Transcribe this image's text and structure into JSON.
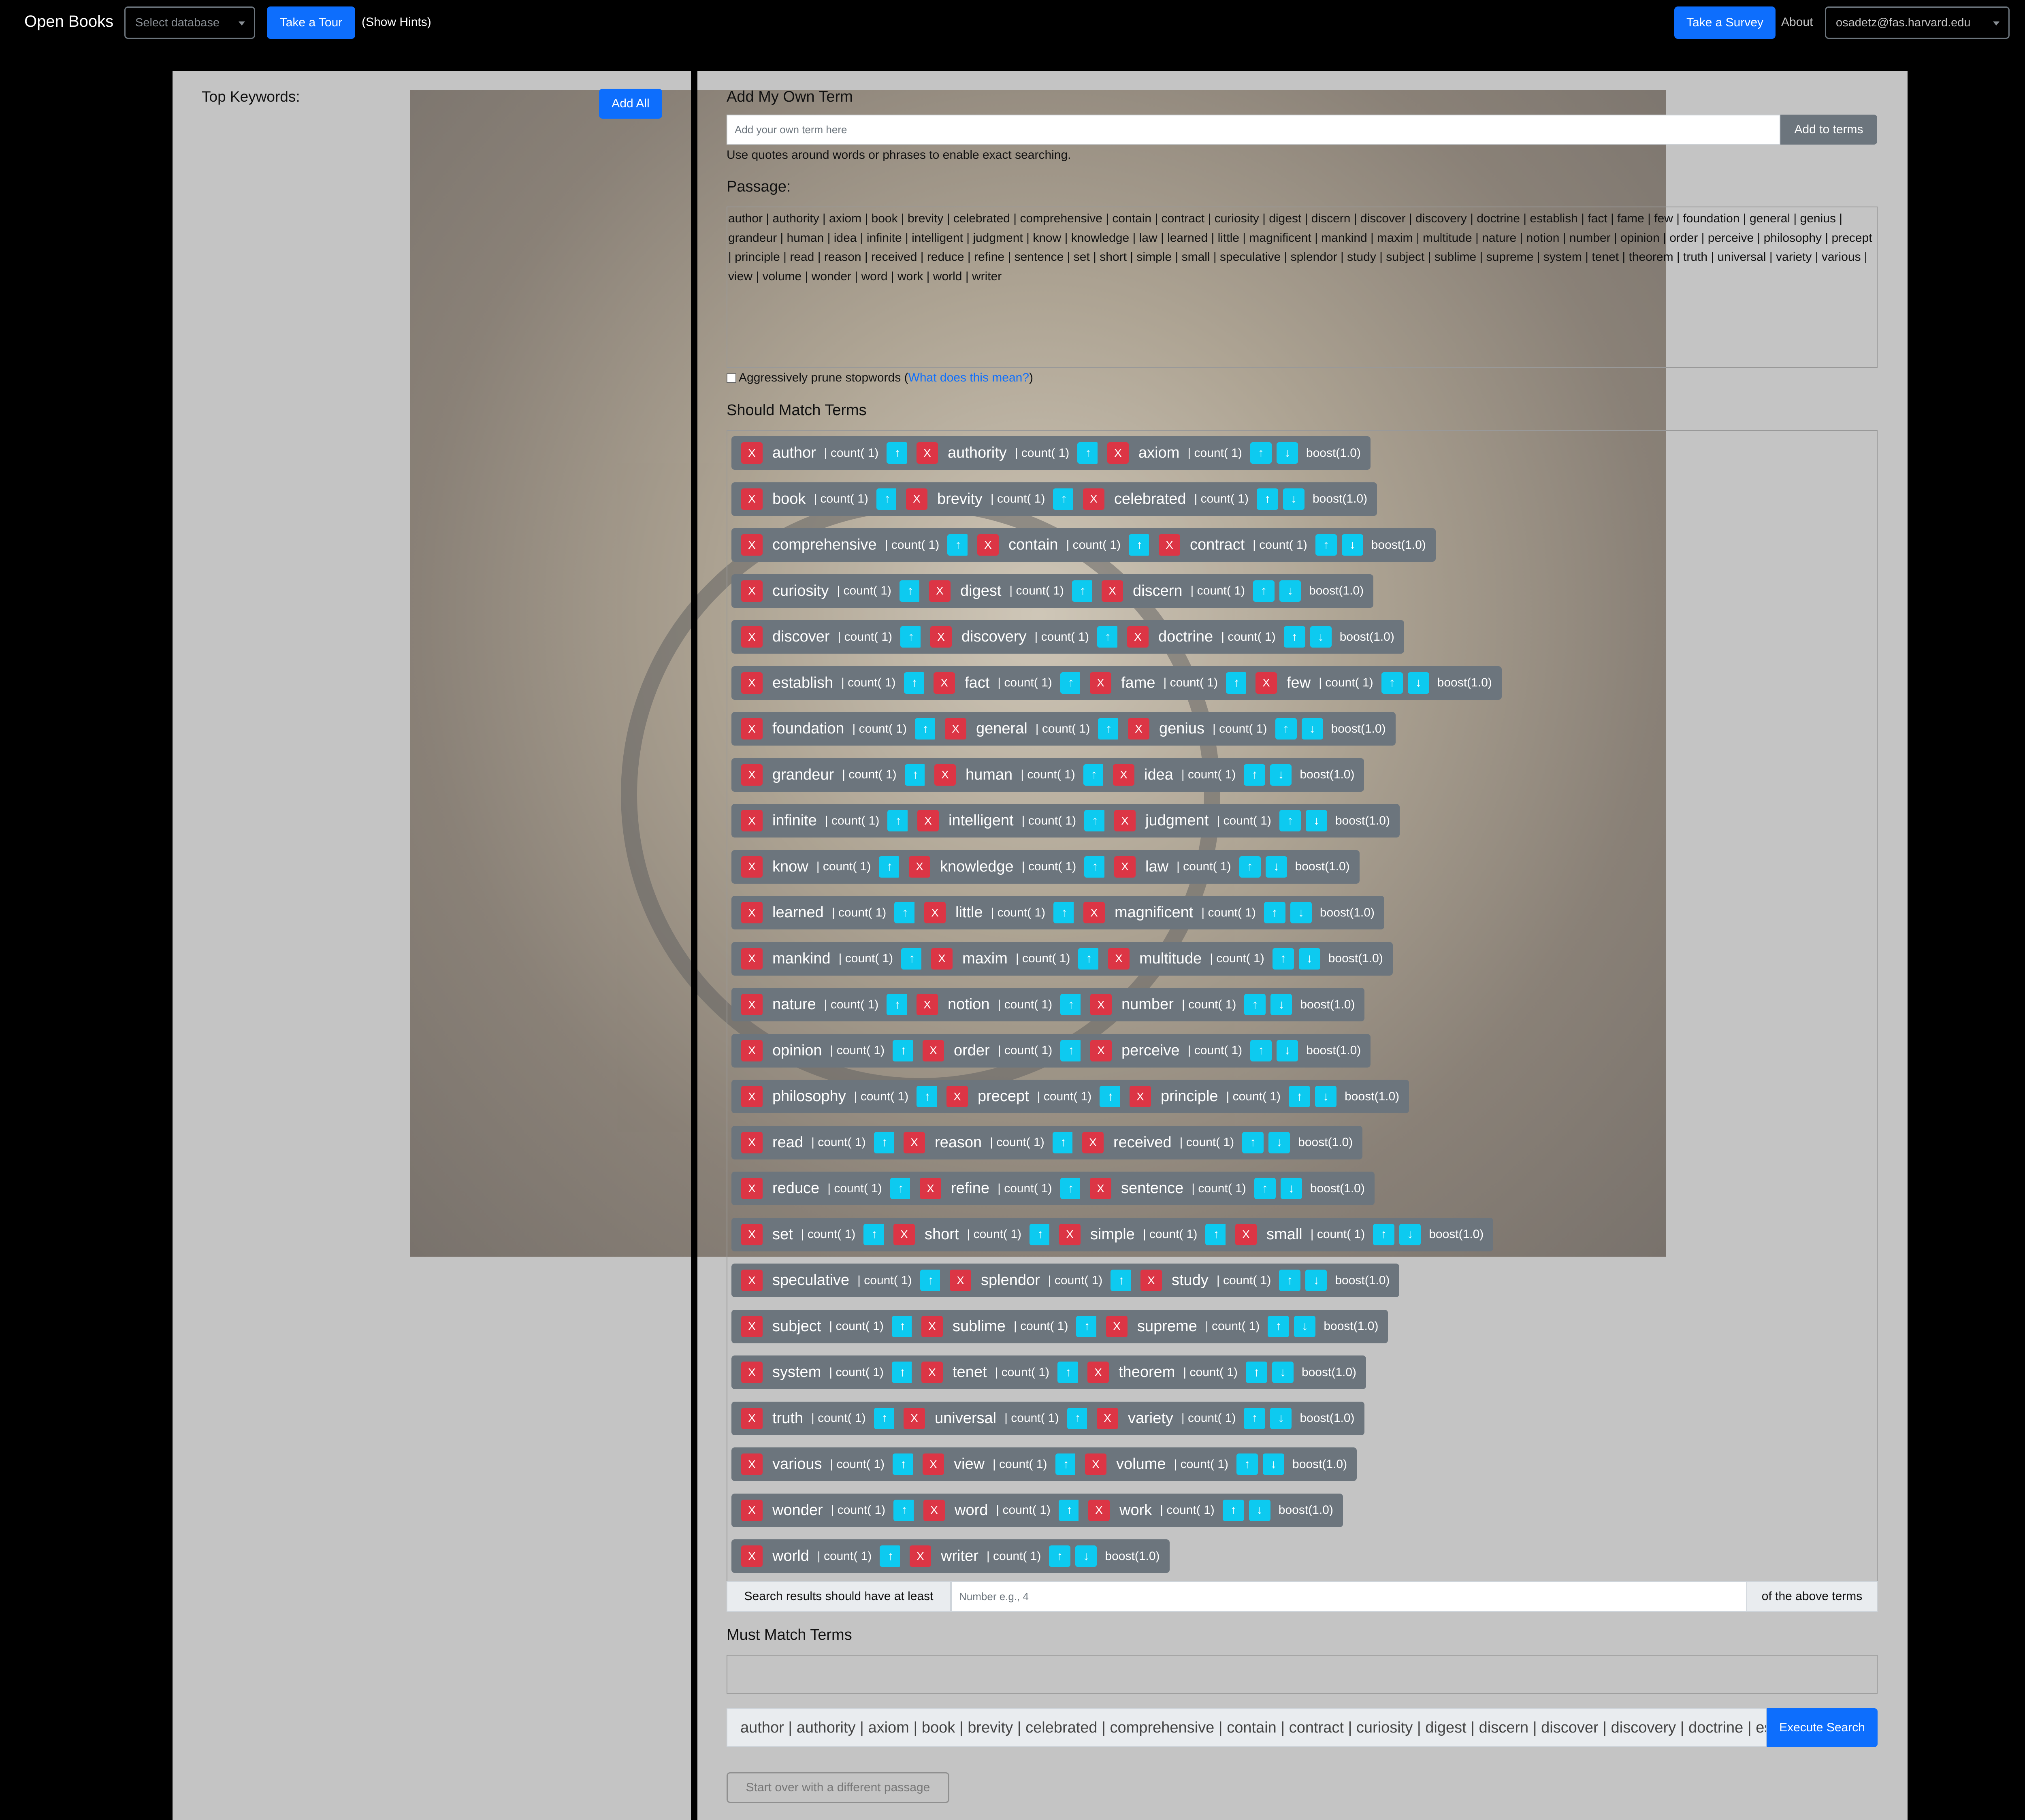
{
  "navbar": {
    "brand": "Open Books",
    "database_select": "Select database",
    "tour_button": "Take a Tour",
    "hints_link": "(Show Hints)",
    "survey_button": "Take a Survey",
    "about_link": "About",
    "user_menu": "osadetz@fas.harvard.edu"
  },
  "left": {
    "title": "Top Keywords:",
    "add_all": "Add All"
  },
  "own_term": {
    "title": "Add My Own Term",
    "placeholder": "Add your own term here",
    "button": "Add to terms",
    "help": "Use quotes around words or phrases to enable exact searching."
  },
  "passage": {
    "title": "Passage:",
    "text": "author | authority | axiom | book | brevity | celebrated | comprehensive | contain | contract | curiosity | digest | discern | discover | discovery | doctrine | establish | fact | fame | few | foundation | general | genius | grandeur | human | idea | infinite | intelligent | judgment | know | knowledge | law | learned | little | magnificent | mankind | maxim | multitude | nature | notion | number | opinion | order | perceive | philosophy | precept | principle | read | reason | received | reduce | refine | sentence | set | short | simple | small | speculative | splendor | study | subject | sublime | supreme | system | tenet | theorem | truth | universal | variety | various | view | volume | wonder | word | work | world | writer",
    "prune_label": "Aggressively prune stopwords (",
    "prune_link": "What does this mean?",
    "prune_close": ")"
  },
  "should": {
    "title": "Should Match Terms",
    "remove": "X",
    "count": "| count( 1)",
    "up": "↑",
    "down": "↓",
    "boost": "boost(1.0)",
    "rows": [
      [
        "author",
        "authority",
        "axiom"
      ],
      [
        "book",
        "brevity",
        "celebrated"
      ],
      [
        "comprehensive",
        "contain",
        "contract"
      ],
      [
        "curiosity",
        "digest",
        "discern"
      ],
      [
        "discover",
        "discovery",
        "doctrine"
      ],
      [
        "establish",
        "fact",
        "fame",
        "few"
      ],
      [
        "foundation",
        "general",
        "genius"
      ],
      [
        "grandeur",
        "human",
        "idea"
      ],
      [
        "infinite",
        "intelligent",
        "judgment"
      ],
      [
        "know",
        "knowledge",
        "law"
      ],
      [
        "learned",
        "little",
        "magnificent"
      ],
      [
        "mankind",
        "maxim",
        "multitude"
      ],
      [
        "nature",
        "notion",
        "number"
      ],
      [
        "opinion",
        "order",
        "perceive"
      ],
      [
        "philosophy",
        "precept",
        "principle"
      ],
      [
        "read",
        "reason",
        "received"
      ],
      [
        "reduce",
        "refine",
        "sentence"
      ],
      [
        "set",
        "short",
        "simple",
        "small"
      ],
      [
        "speculative",
        "splendor",
        "study"
      ],
      [
        "subject",
        "sublime",
        "supreme"
      ],
      [
        "system",
        "tenet",
        "theorem"
      ],
      [
        "truth",
        "universal",
        "variety"
      ],
      [
        "various",
        "view",
        "volume"
      ],
      [
        "wonder",
        "word",
        "work"
      ],
      [
        "world",
        "writer"
      ]
    ],
    "min_label": "Search results should have at least",
    "min_placeholder": "Number e.g., 4",
    "min_suffix": "of the above terms"
  },
  "must": {
    "title": "Must Match Terms",
    "query": "author | authority | axiom | book | brevity | celebrated | comprehensive | contain | contract | curiosity | digest | discern | discover | discovery | doctrine | establish | fact | fame | few | foundation | general | genius | grandeur | human | idea",
    "execute": "Execute Search",
    "start_over": "Start over with a different passage"
  },
  "colors": {
    "primary": "#0d6efd",
    "danger": "#dc3545",
    "info": "#0dcaf0",
    "secondary": "#6c757d",
    "panel": "#c4c4c4"
  },
  "icons": {
    "remove": "close-icon",
    "up": "arrow-up-icon",
    "down": "arrow-down-icon",
    "dropdown": "chevron-down-icon"
  }
}
